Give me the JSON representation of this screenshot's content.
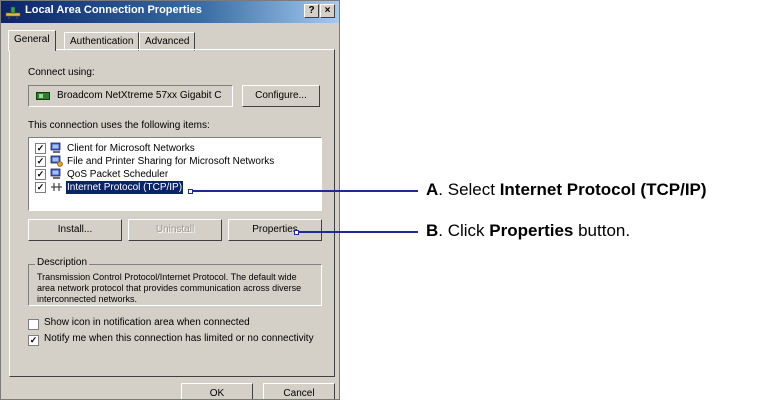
{
  "window": {
    "title": "Local Area Connection Properties",
    "help_label": "?",
    "close_label": "×"
  },
  "tabs": [
    {
      "label": "General"
    },
    {
      "label": "Authentication"
    },
    {
      "label": "Advanced"
    }
  ],
  "general": {
    "connect_using_label": "Connect using:",
    "adapter_name": "Broadcom NetXtreme 57xx Gigabit C",
    "configure_label": "Configure...",
    "items_label": "This connection uses the following items:",
    "items": [
      {
        "label": "Client for Microsoft Networks",
        "checked": "✓",
        "icon": "network-client-icon"
      },
      {
        "label": "File and Printer Sharing for Microsoft Networks",
        "checked": "✓",
        "icon": "file-printer-sharing-icon"
      },
      {
        "label": "QoS Packet Scheduler",
        "checked": "✓",
        "icon": "qos-scheduler-icon"
      },
      {
        "label": "Internet Protocol (TCP/IP)",
        "checked": "✓",
        "icon": "protocol-icon",
        "selected": true
      }
    ],
    "install_label": "Install...",
    "uninstall_label": "Uninstall",
    "properties_label": "Properties",
    "description_title": "Description",
    "description_text": "Transmission Control Protocol/Internet Protocol. The default wide area network protocol that provides communication across diverse interconnected networks.",
    "show_icon_label": "Show icon in notification area when connected",
    "show_icon_checked": "",
    "notify_label": "Notify me when this connection has limited or no connectivity",
    "notify_checked": "✓"
  },
  "footer": {
    "ok_label": "OK",
    "cancel_label": "Cancel"
  },
  "annotations": {
    "a_letter": "A",
    "a_text": ". Select ",
    "a_bold": "Internet Protocol (TCP/IP)",
    "b_letter": "B",
    "b_text": ". Click ",
    "b_bold": "Properties",
    "b_tail": " button."
  },
  "colors": {
    "title_bar": "#0a246a",
    "selection": "#0a246a",
    "callout_line": "#1e2a9a"
  }
}
